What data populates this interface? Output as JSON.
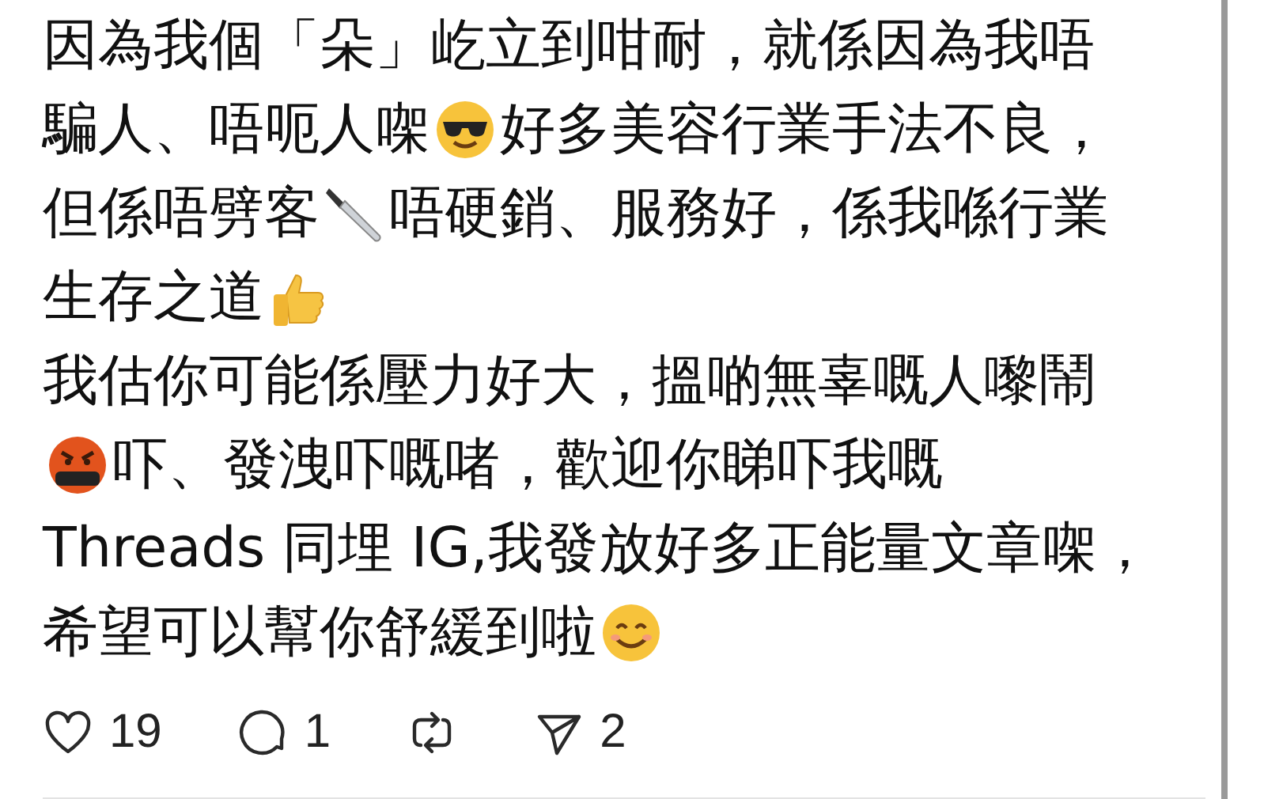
{
  "post": {
    "lines": [
      [
        {
          "kind": "text",
          "text": "因為我個「朵」屹立到咁耐，就係因為我唔"
        }
      ],
      [
        {
          "kind": "text",
          "text": "騙人、唔呃人㗎"
        },
        {
          "kind": "cool-face"
        },
        {
          "kind": "text",
          "text": "好多美容行業手法不良，"
        }
      ],
      [
        {
          "kind": "text",
          "text": "但係唔劈客"
        },
        {
          "kind": "knife"
        },
        {
          "kind": "text",
          "text": "唔硬銷、服務好，係我喺行業"
        }
      ],
      [
        {
          "kind": "text",
          "text": "生存之道"
        },
        {
          "kind": "thumbs-up"
        }
      ],
      [
        {
          "kind": "text",
          "text": "我估你可能係壓力好大，搵啲無辜嘅人嚟鬧"
        }
      ],
      [
        {
          "kind": "cursing-face"
        },
        {
          "kind": "text",
          "text": "吓、發洩吓嘅啫，歡迎你睇吓我嘅"
        }
      ],
      [
        {
          "kind": "text",
          "text": "Threads 同埋 IG,我發放好多正能量文章㗎，"
        }
      ],
      [
        {
          "kind": "text",
          "text": "希望可以幫你舒緩到啦"
        },
        {
          "kind": "smile-face"
        }
      ]
    ]
  },
  "actions": [
    {
      "kind": "like",
      "count": "19"
    },
    {
      "kind": "reply",
      "count": "1"
    },
    {
      "kind": "repost"
    },
    {
      "kind": "share",
      "count": "2"
    }
  ]
}
